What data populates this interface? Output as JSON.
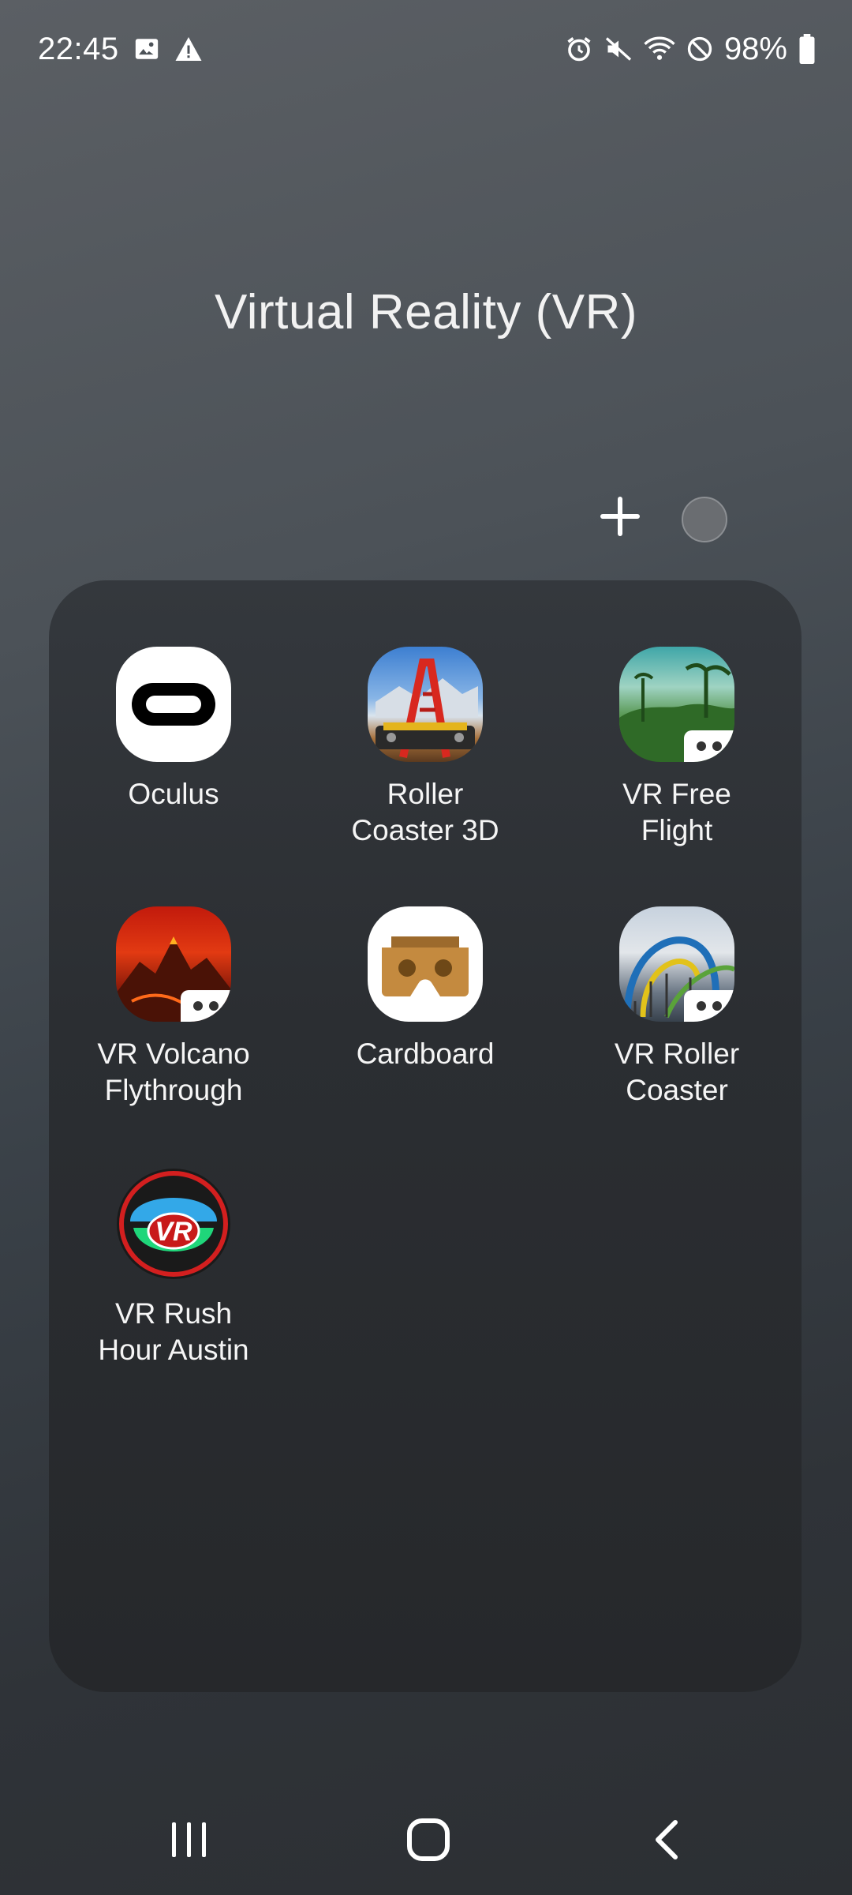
{
  "status_bar": {
    "time": "22:45",
    "battery": "98%",
    "left_icons": [
      "image-icon",
      "warning-icon"
    ],
    "right_icons": [
      "alarm-icon",
      "mute-icon",
      "wifi-icon",
      "do-not-disturb-icon",
      "battery-icon"
    ]
  },
  "folder": {
    "title": "Virtual Reality (VR)",
    "add_icon": "plus-icon",
    "color_swatch": "#6a6d71",
    "apps": [
      {
        "name": "Oculus",
        "icon": "oculus-icon"
      },
      {
        "name": "Roller\nCoaster 3D",
        "icon": "roller-coaster-3d-icon"
      },
      {
        "name": "VR Free\nFlight",
        "icon": "vr-free-flight-icon"
      },
      {
        "name": "VR Volcano\nFlythrough",
        "icon": "vr-volcano-icon"
      },
      {
        "name": "Cardboard",
        "icon": "cardboard-icon"
      },
      {
        "name": "VR Roller\nCoaster",
        "icon": "vr-roller-coaster-icon"
      },
      {
        "name": "VR Rush\nHour Austin",
        "icon": "vr-rush-hour-icon"
      }
    ],
    "vr_rush_badge": "VR"
  },
  "nav_bar": {
    "icons": [
      "recents-icon",
      "home-icon",
      "back-icon"
    ]
  }
}
